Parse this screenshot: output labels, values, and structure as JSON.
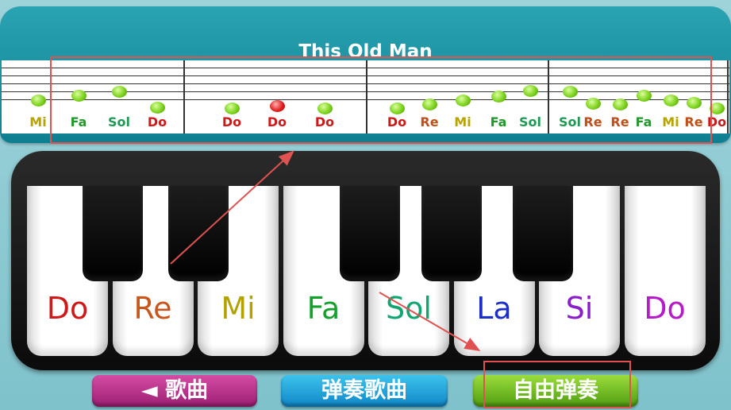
{
  "song_title": "This Old Man",
  "staff": {
    "notes": [
      {
        "label": "Mi",
        "color": "#b8a300"
      },
      {
        "label": "Fa",
        "color": "#1f9a2a"
      },
      {
        "label": "Sol",
        "color": "#1f9a55"
      },
      {
        "label": "Do",
        "color": "#cc1a1a"
      },
      {
        "label": "Do",
        "color": "#cc1a1a"
      },
      {
        "label": "Do",
        "color": "#cc1a1a",
        "active": true
      },
      {
        "label": "Do",
        "color": "#cc1a1a"
      },
      {
        "label": "Do",
        "color": "#cc1a1a"
      },
      {
        "label": "Re",
        "color": "#c0501a"
      },
      {
        "label": "Mi",
        "color": "#b8a300"
      },
      {
        "label": "Fa",
        "color": "#1f9a2a"
      },
      {
        "label": "Sol",
        "color": "#1f9a55"
      },
      {
        "label": "Sol",
        "color": "#1f9a55"
      },
      {
        "label": "Re",
        "color": "#c0501a"
      },
      {
        "label": "Re",
        "color": "#c0501a"
      },
      {
        "label": "Fa",
        "color": "#1f9a2a"
      },
      {
        "label": "Mi",
        "color": "#b8a300"
      },
      {
        "label": "Re",
        "color": "#c0501a"
      },
      {
        "label": "Do",
        "color": "#cc1a1a"
      }
    ]
  },
  "piano": {
    "white_keys": [
      {
        "label": "Do",
        "color": "#d01818"
      },
      {
        "label": "Re",
        "color": "#c9561c"
      },
      {
        "label": "Mi",
        "color": "#b3a100"
      },
      {
        "label": "Fa",
        "color": "#14a02d"
      },
      {
        "label": "Sol",
        "color": "#13a56f"
      },
      {
        "label": "La",
        "color": "#1c2fc8"
      },
      {
        "label": "Si",
        "color": "#8a1ec8"
      },
      {
        "label": "Do",
        "color": "#b51cc8"
      }
    ]
  },
  "buttons": {
    "songs": "◄ 歌曲",
    "play_song": "弹奏歌曲",
    "free_play": "自由弹奏"
  },
  "colors": {
    "accent": "#0f8a9b",
    "annotation": "#e05252"
  }
}
